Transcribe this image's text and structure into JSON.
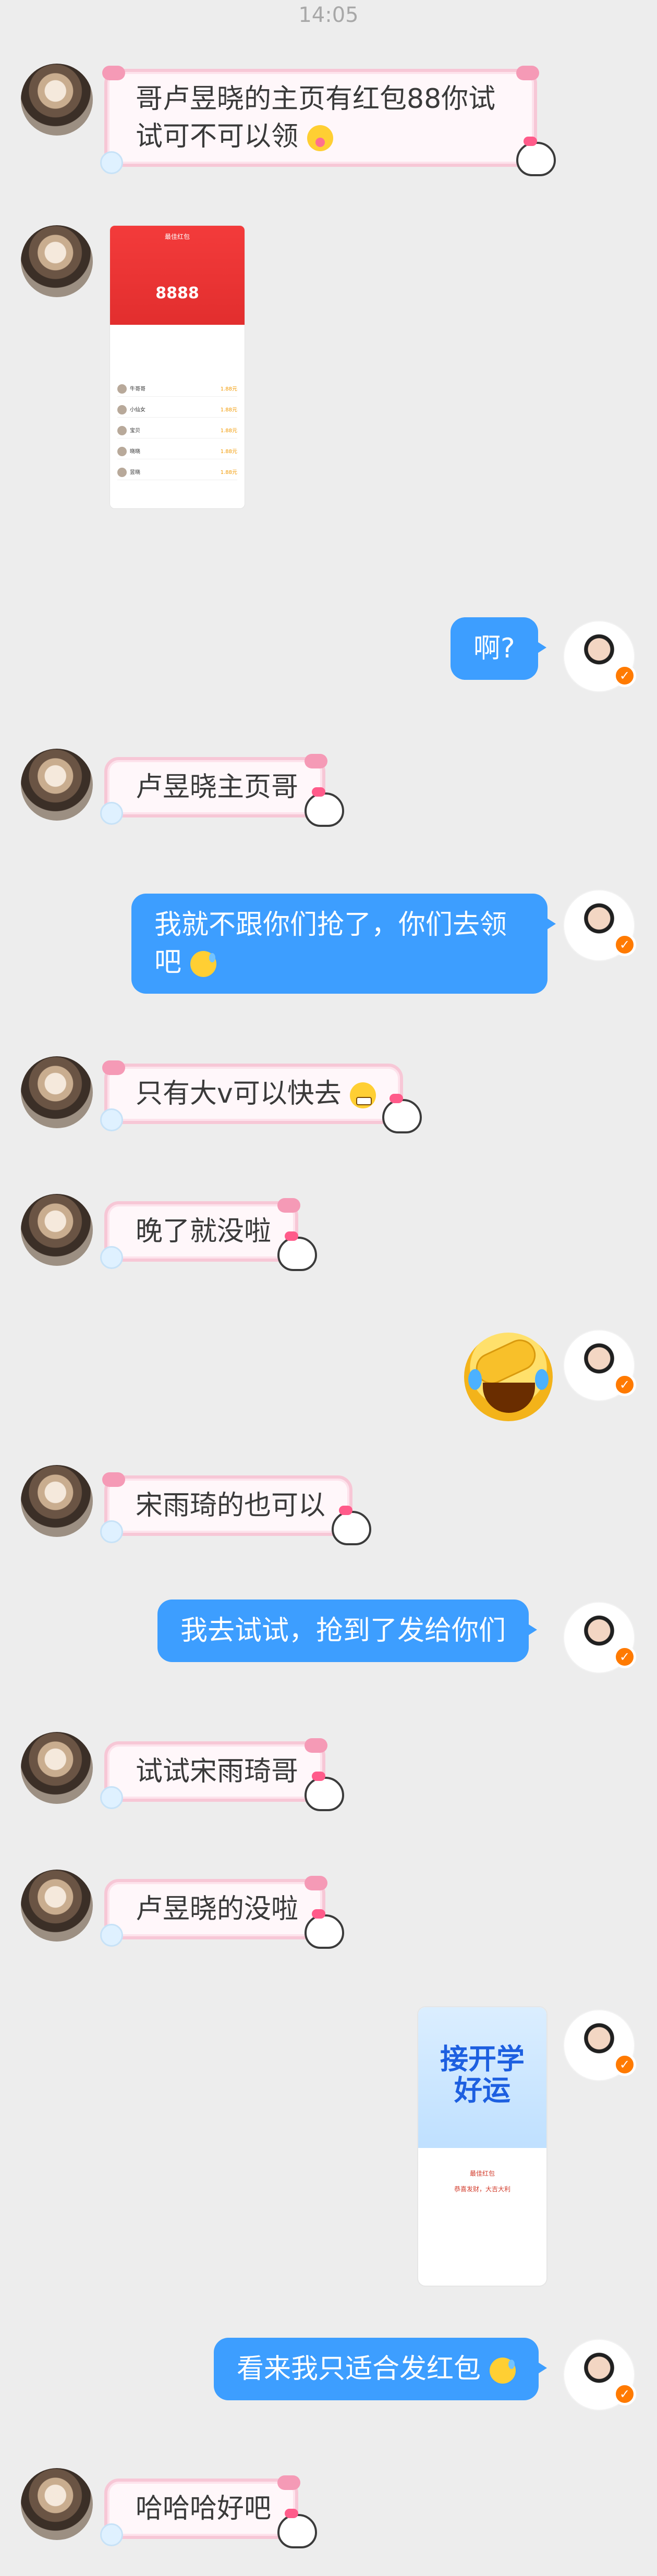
{
  "status": {
    "time": "14:05"
  },
  "colors": {
    "blue_bubble": "#3d9eff",
    "pink_border": "#f7c7d6",
    "badge": "#ff7a00"
  },
  "messages": [
    {
      "id": "m1",
      "sender": "her",
      "text": "哥卢昱晓的主页有红包88你试试可不可以领",
      "emoji": "pout-icon"
    },
    {
      "id": "m2",
      "sender": "her",
      "type": "image",
      "image": {
        "amount": "8888",
        "header": "最佳红包",
        "rows": [
          {
            "name": "牛哥哥",
            "amount": "1.88元"
          },
          {
            "name": "小仙女",
            "amount": "1.88元"
          },
          {
            "name": "宝贝",
            "amount": "1.88元"
          },
          {
            "name": "晓晓",
            "amount": "1.88元"
          },
          {
            "name": "昱晓",
            "amount": "1.88元"
          }
        ]
      }
    },
    {
      "id": "m3",
      "sender": "me",
      "text": "啊?"
    },
    {
      "id": "m4",
      "sender": "her",
      "text": "卢昱晓主页哥"
    },
    {
      "id": "m5",
      "sender": "me",
      "text": "我就不跟你们抢了，你们去领吧",
      "emoji": "sweat-icon"
    },
    {
      "id": "m6",
      "sender": "her",
      "text": "只有大v可以快去",
      "emoji": "grimace-icon"
    },
    {
      "id": "m7",
      "sender": "her",
      "text": "晚了就没啦"
    },
    {
      "id": "m8",
      "sender": "me",
      "type": "sticker",
      "emoji": "laugh-cry-icon"
    },
    {
      "id": "m9",
      "sender": "her",
      "text": "宋雨琦的也可以"
    },
    {
      "id": "m10",
      "sender": "me",
      "text": "我去试试，抢到了发给你们"
    },
    {
      "id": "m11",
      "sender": "her",
      "text": "试试宋雨琦哥"
    },
    {
      "id": "m12",
      "sender": "her",
      "text": "卢昱晓的没啦"
    },
    {
      "id": "m13",
      "sender": "me",
      "type": "image",
      "image": {
        "title_line1": "接开学",
        "title_line2": "好运",
        "line1": "最佳红包",
        "line2": "恭喜发财，大吉大利"
      }
    },
    {
      "id": "m14",
      "sender": "me",
      "text": "看来我只适合发红包",
      "emoji": "sweat-icon"
    },
    {
      "id": "m15",
      "sender": "her",
      "text": "哈哈哈好吧"
    }
  ]
}
